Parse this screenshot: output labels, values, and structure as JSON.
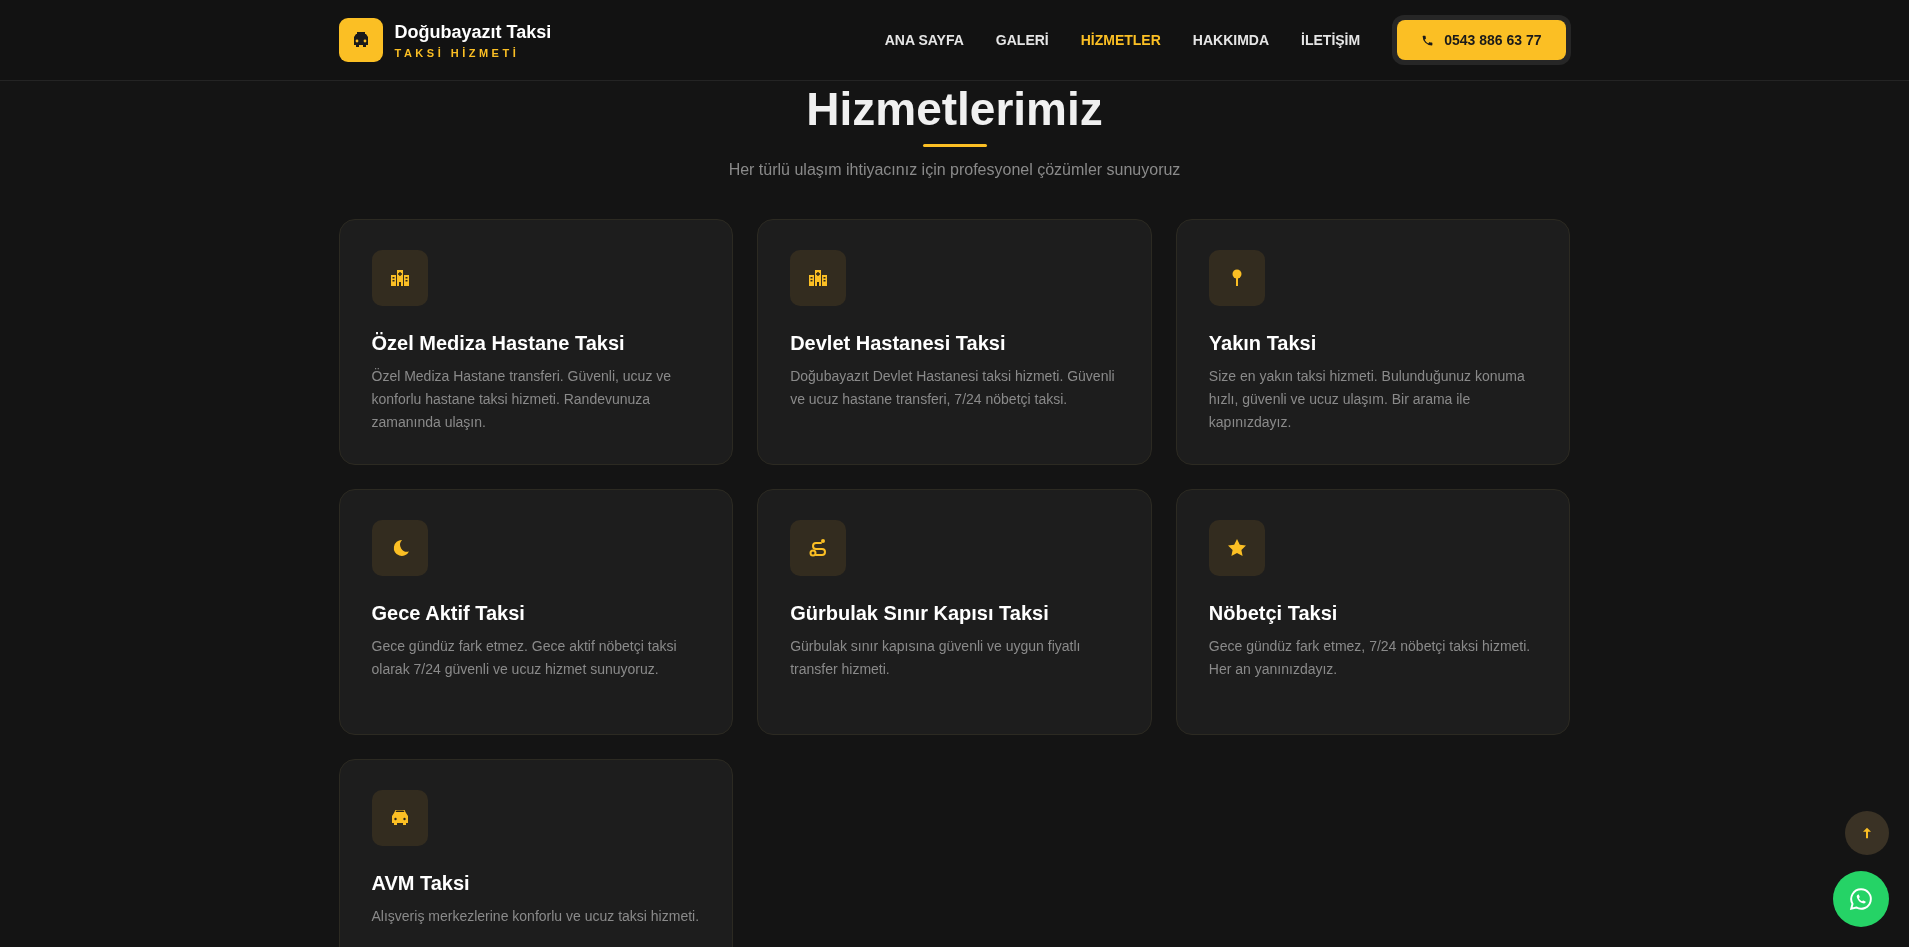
{
  "header": {
    "brand": "Doğubayazıt Taksi",
    "tagline": "TAKSİ HİZMETİ",
    "nav": [
      {
        "label": "ANA SAYFA",
        "selected": false
      },
      {
        "label": "GALERİ",
        "selected": false
      },
      {
        "label": "HİZMETLER",
        "selected": true
      },
      {
        "label": "HAKKIMDA",
        "selected": false
      },
      {
        "label": "İLETİŞİM",
        "selected": false
      }
    ],
    "phone": "0543 886 63 77"
  },
  "section": {
    "title": "Hizmetlerimiz",
    "subtitle": "Her türlü ulaşım ihtiyacınız için profesyonel çözümler sunuyoruz"
  },
  "cards": [
    {
      "title": "Özel Mediza Hastane Taksi",
      "text": "Özel Mediza Hastane transferi. Güvenli, ucuz ve konforlu hastane taksi hizmeti. Randevunuza zamanında ulaşın."
    },
    {
      "title": "Devlet Hastanesi Taksi",
      "text": "Doğubayazıt Devlet Hastanesi taksi hizmeti. Güvenli ve ucuz hastane transferi, 7/24 nöbetçi taksi."
    },
    {
      "title": "Yakın Taksi",
      "text": "Size en yakın taksi hizmeti. Bulunduğunuz konuma hızlı, güvenli ve ucuz ulaşım. Bir arama ile kapınızdayız."
    },
    {
      "title": "Gece Aktif Taksi",
      "text": "Gece gündüz fark etmez. Gece aktif nöbetçi taksi olarak 7/24 güvenli ve ucuz hizmet sunuyoruz."
    },
    {
      "title": "Gürbulak Sınır Kapısı Taksi",
      "text": "Gürbulak sınır kapısına güvenli ve uygun fiyatlı transfer hizmeti."
    },
    {
      "title": "Nöbetçi Taksi",
      "text": "Gece gündüz fark etmez, 7/24 nöbetçi taksi hizmeti. Her an yanınızdayız."
    },
    {
      "title": "AVM Taksi",
      "text": "Alışveriş merkezlerine konforlu ve ucuz taksi hizmeti."
    }
  ]
}
